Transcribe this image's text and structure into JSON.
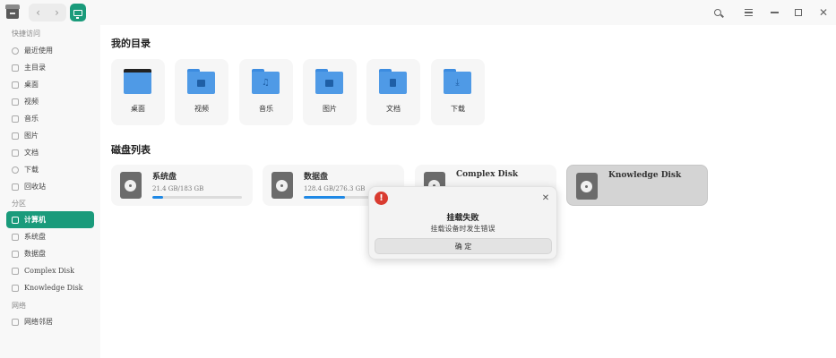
{
  "titlebar": {
    "back_icon": "chevron-left-icon",
    "forward_icon": "chevron-right-icon",
    "close_glyph": "✕",
    "back_glyph": "‹",
    "forward_glyph": "›"
  },
  "sidebar": {
    "quick_access_title": "快捷访问",
    "quick_items": [
      {
        "label": "最近使用",
        "icon": "clock-icon"
      },
      {
        "label": "主目录",
        "icon": "home-icon"
      },
      {
        "label": "桌面",
        "icon": "desktop-icon"
      },
      {
        "label": "视频",
        "icon": "video-icon"
      },
      {
        "label": "音乐",
        "icon": "music-icon"
      },
      {
        "label": "图片",
        "icon": "picture-icon"
      },
      {
        "label": "文档",
        "icon": "document-icon"
      },
      {
        "label": "下载",
        "icon": "download-icon"
      },
      {
        "label": "回收站",
        "icon": "trash-icon"
      }
    ],
    "partition_title": "分区",
    "partition_items": [
      {
        "label": "计算机",
        "icon": "computer-icon",
        "active": true
      },
      {
        "label": "系统盘",
        "icon": "disk-icon"
      },
      {
        "label": "数据盘",
        "icon": "disk-icon"
      },
      {
        "label": "Complex Disk",
        "icon": "disk-icon"
      },
      {
        "label": "Knowledge Disk",
        "icon": "disk-icon"
      }
    ],
    "network_title": "网络",
    "network_items": [
      {
        "label": "网络邻居",
        "icon": "network-icon"
      }
    ]
  },
  "main": {
    "my_dirs_title": "我的目录",
    "folders": [
      {
        "label": "桌面",
        "icon": "desktop-folder-icon"
      },
      {
        "label": "视频",
        "icon": "video-folder-icon"
      },
      {
        "label": "音乐",
        "icon": "music-folder-icon"
      },
      {
        "label": "图片",
        "icon": "picture-folder-icon"
      },
      {
        "label": "文档",
        "icon": "document-folder-icon"
      },
      {
        "label": "下载",
        "icon": "download-folder-icon"
      }
    ],
    "disks_title": "磁盘列表",
    "disks": [
      {
        "name": "系统盘",
        "size": "21.4 GB/183 GB",
        "usage": 0.12
      },
      {
        "name": "数据盘",
        "size": "128.4 GB/276.3 GB",
        "usage": 0.46
      },
      {
        "name": "Complex Disk",
        "size": "",
        "usage": 0
      },
      {
        "name": "Knowledge Disk",
        "size": "",
        "usage": 0,
        "selected": true
      }
    ]
  },
  "dialog": {
    "title": "挂载失败",
    "message": "挂载设备时发生错误",
    "confirm_label": "确 定",
    "icon": "warning-icon",
    "icon_glyph": "!",
    "close_glyph": "✕",
    "accent_color": "#d93b30"
  },
  "colors": {
    "accent": "#1a9b7b",
    "folder_blue": "#4f9ae6",
    "progress_blue": "#1e88e5"
  }
}
